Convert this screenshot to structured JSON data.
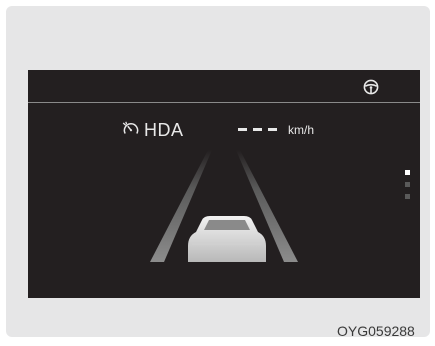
{
  "display": {
    "function_label": "HDA",
    "speed_value": "---",
    "speed_unit": "km/h",
    "active_page_index": 0,
    "page_count": 3
  },
  "icons": {
    "top_right": "steering-wheel-icon",
    "function": "hda-speedometer-icon"
  },
  "caption": {
    "figure_code": "OYG059288"
  },
  "colors": {
    "screen_background": "#231f20",
    "panel_background": "#e6e6e7",
    "text": "#e8e8e8"
  }
}
